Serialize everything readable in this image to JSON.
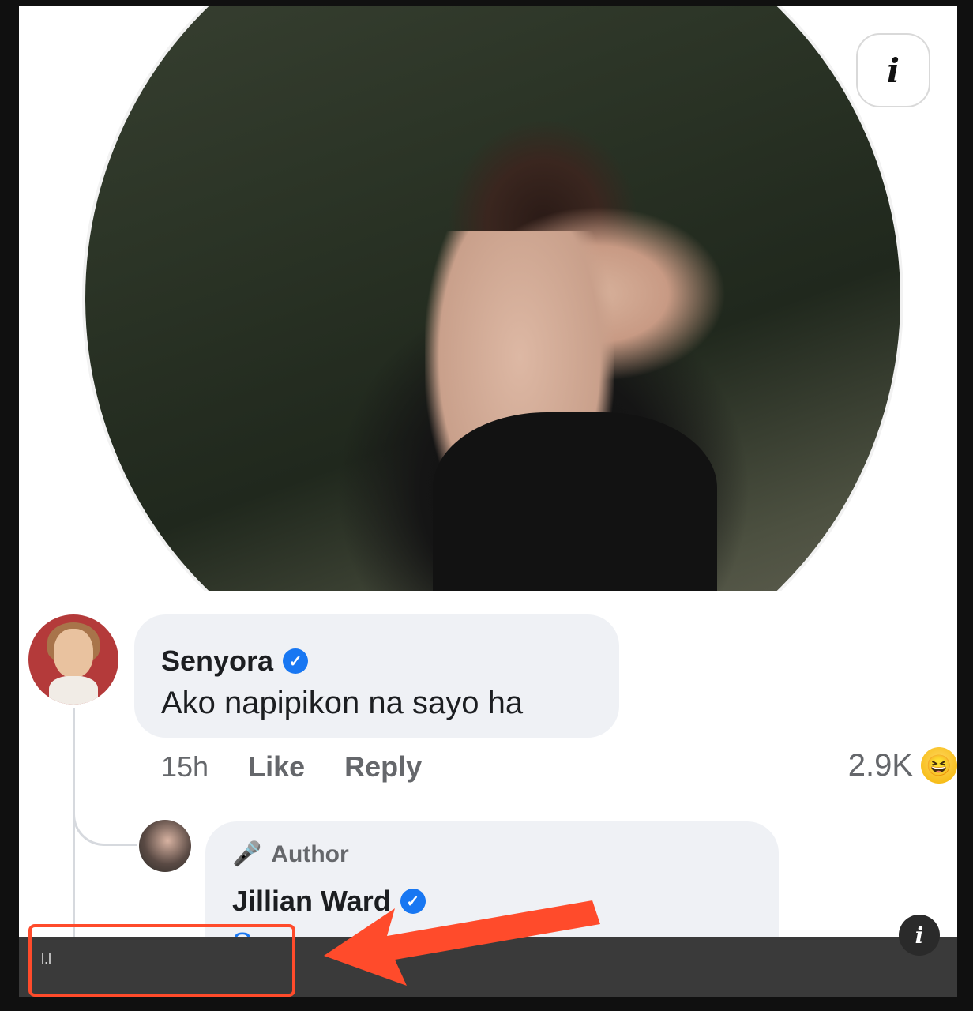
{
  "cover_photo": {
    "info_icon": "info-icon"
  },
  "comment": {
    "author": "Senyora",
    "verified": true,
    "text": "Ako napipikon na sayo ha",
    "time": "15h",
    "like_label": "Like",
    "reply_label": "Reply",
    "reaction_count": "2.9K",
    "reaction_icon": "haha-emoji-icon"
  },
  "reply": {
    "badge_label": "Author",
    "badge_icon": "microphone-icon",
    "author": "Jillian Ward",
    "verified": true,
    "text_partial": "Senyora          po, Senyora"
  },
  "viewer_bar": {
    "text": "l.l",
    "info_icon": "info-icon"
  },
  "annotation": {
    "color": "#ff4b2b"
  },
  "colors": {
    "verified_blue": "#1877f2",
    "bubble_bg": "#eff1f5",
    "meta_gray": "#65676b"
  }
}
